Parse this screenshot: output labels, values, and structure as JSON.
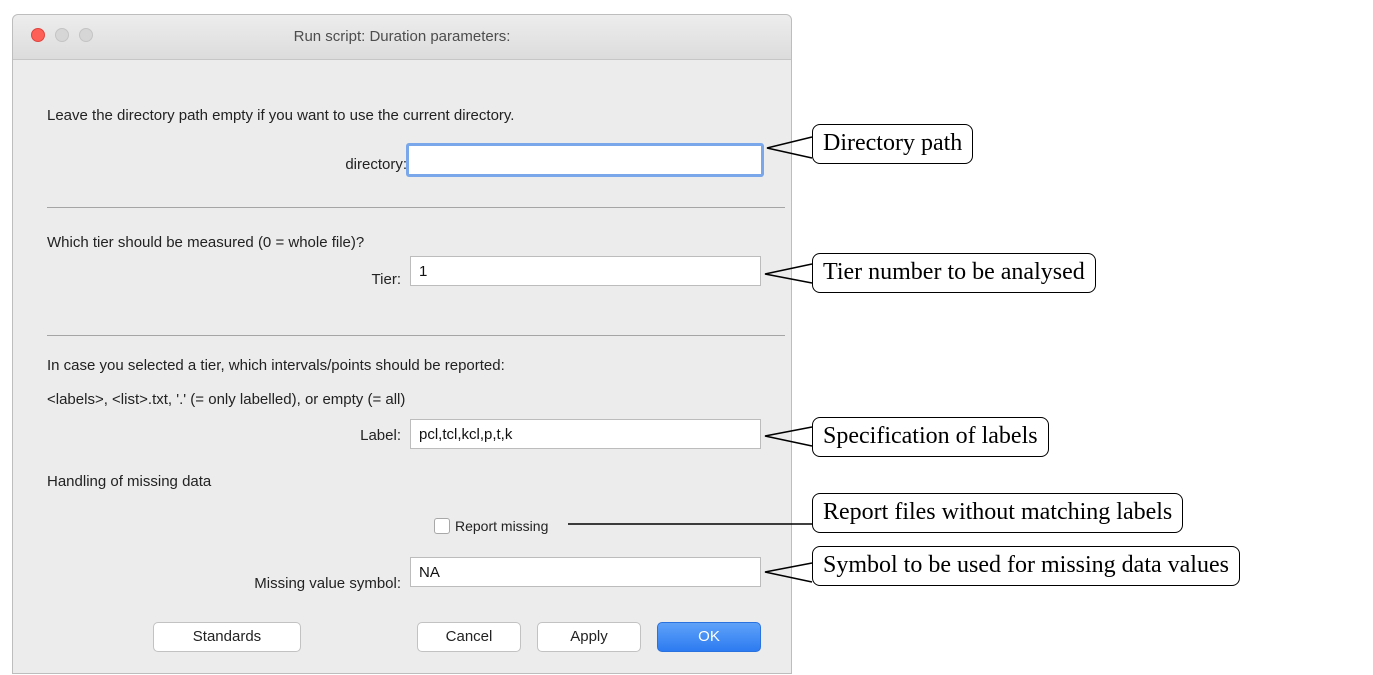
{
  "window": {
    "title": "Run script: Duration parameters:"
  },
  "form": {
    "directory_hint": "Leave the directory path empty if you want to use the current directory.",
    "directory_label": "directory:",
    "directory_value": "",
    "tier_question": "Which tier should be measured (0 = whole file)?",
    "tier_label": "Tier:",
    "tier_value": "1",
    "labels_question": "In case you selected a tier, which intervals/points should be reported:",
    "labels_hint": "<labels>, <list>.txt, '.' (= only labelled), or empty (= all)",
    "label_label": "Label:",
    "label_value": "pcl,tcl,kcl,p,t,k",
    "missing_heading": "Handling of missing data",
    "report_missing_label": "Report missing",
    "report_missing_checked": false,
    "missing_symbol_label": "Missing value symbol:",
    "missing_symbol_value": "NA"
  },
  "buttons": {
    "standards": "Standards",
    "cancel": "Cancel",
    "apply": "Apply",
    "ok": "OK"
  },
  "annotations": {
    "directory": "Directory path",
    "tier": "Tier number to be analysed",
    "labels": "Specification of labels",
    "report_missing": "Report files without matching labels",
    "missing_symbol": "Symbol to be used for missing data values"
  },
  "colors": {
    "ok_button": "#2d7bf1",
    "close_button": "#fe5f57",
    "focus_ring": "#7aa7e9",
    "window_background": "#ececec"
  }
}
